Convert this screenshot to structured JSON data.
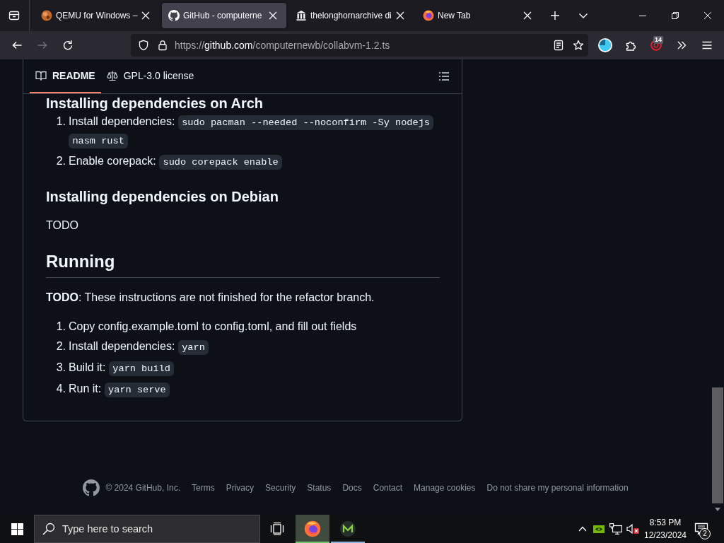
{
  "browser": {
    "tabs": [
      {
        "title": "QEMU for Windows –",
        "selected": false
      },
      {
        "title": "GitHub - computerne",
        "selected": true
      },
      {
        "title": "thelonghornarchive di",
        "selected": false
      },
      {
        "title": "New Tab",
        "selected": false
      }
    ],
    "navigation": {
      "back_disabled": false,
      "forward_disabled": true
    },
    "address": {
      "scheme": "https://",
      "domain": "github.com",
      "path": "/computernewb/collabvm-1.2.ts"
    },
    "extension_badge": "14"
  },
  "readme": {
    "tabs": [
      {
        "label": "README",
        "selected": true
      },
      {
        "label": "GPL-3.0 license",
        "selected": false
      }
    ],
    "blocks": [
      {
        "kind": "top_heading",
        "text": "Installing dependencies on Arch"
      },
      {
        "kind": "list",
        "items": [
          {
            "number": "1.",
            "parts": [
              {
                "kind": "text",
                "text": "Install dependencies:"
              },
              {
                "kind": "code",
                "text": "sudo pacman --needed --noconfirm -Sy nodejs"
              },
              {
                "kind": "code",
                "text": "nasm rust"
              }
            ]
          },
          {
            "number": "2.",
            "parts": [
              {
                "kind": "text",
                "text": "Enable corepack:"
              },
              {
                "kind": "code",
                "text": "sudo corepack enable"
              }
            ]
          }
        ]
      },
      {
        "kind": "h3",
        "text": "Installing dependencies on Debian"
      },
      {
        "kind": "p",
        "text": "TODO"
      },
      {
        "kind": "h2",
        "text": "Running"
      },
      {
        "kind": "p",
        "text": "**TODO**: These instructions are not finished for the refactor branch."
      },
      {
        "kind": "list",
        "items": [
          {
            "number": "1.",
            "parts": [
              {
                "kind": "text",
                "text": "Copy config.example.toml to config.toml, and fill out fields"
              }
            ]
          },
          {
            "number": "2.",
            "parts": [
              {
                "kind": "text",
                "text": "Install dependencies:"
              },
              {
                "kind": "code",
                "text": "yarn"
              }
            ]
          },
          {
            "number": "3.",
            "parts": [
              {
                "kind": "text",
                "text": "Build it:"
              },
              {
                "kind": "code",
                "text": "yarn build"
              }
            ]
          },
          {
            "number": "4.",
            "parts": [
              {
                "kind": "text",
                "text": "Run it:"
              },
              {
                "kind": "code",
                "text": "yarn serve"
              }
            ]
          }
        ]
      }
    ]
  },
  "footer": {
    "copyright": "© 2024 GitHub, Inc.",
    "links": [
      "Terms",
      "Privacy",
      "Security",
      "Status",
      "Docs",
      "Contact",
      "Manage cookies",
      "Do not share my personal information"
    ]
  },
  "taskbar": {
    "search": {
      "placeholder": "Type here to search"
    },
    "apps": [
      {
        "selected": true
      },
      {
        "selected": false
      }
    ],
    "tray": {
      "volume_muted": true
    },
    "clock": {
      "time": "8:53 PM",
      "date": "12/23/2024"
    },
    "notification_count": "2"
  }
}
